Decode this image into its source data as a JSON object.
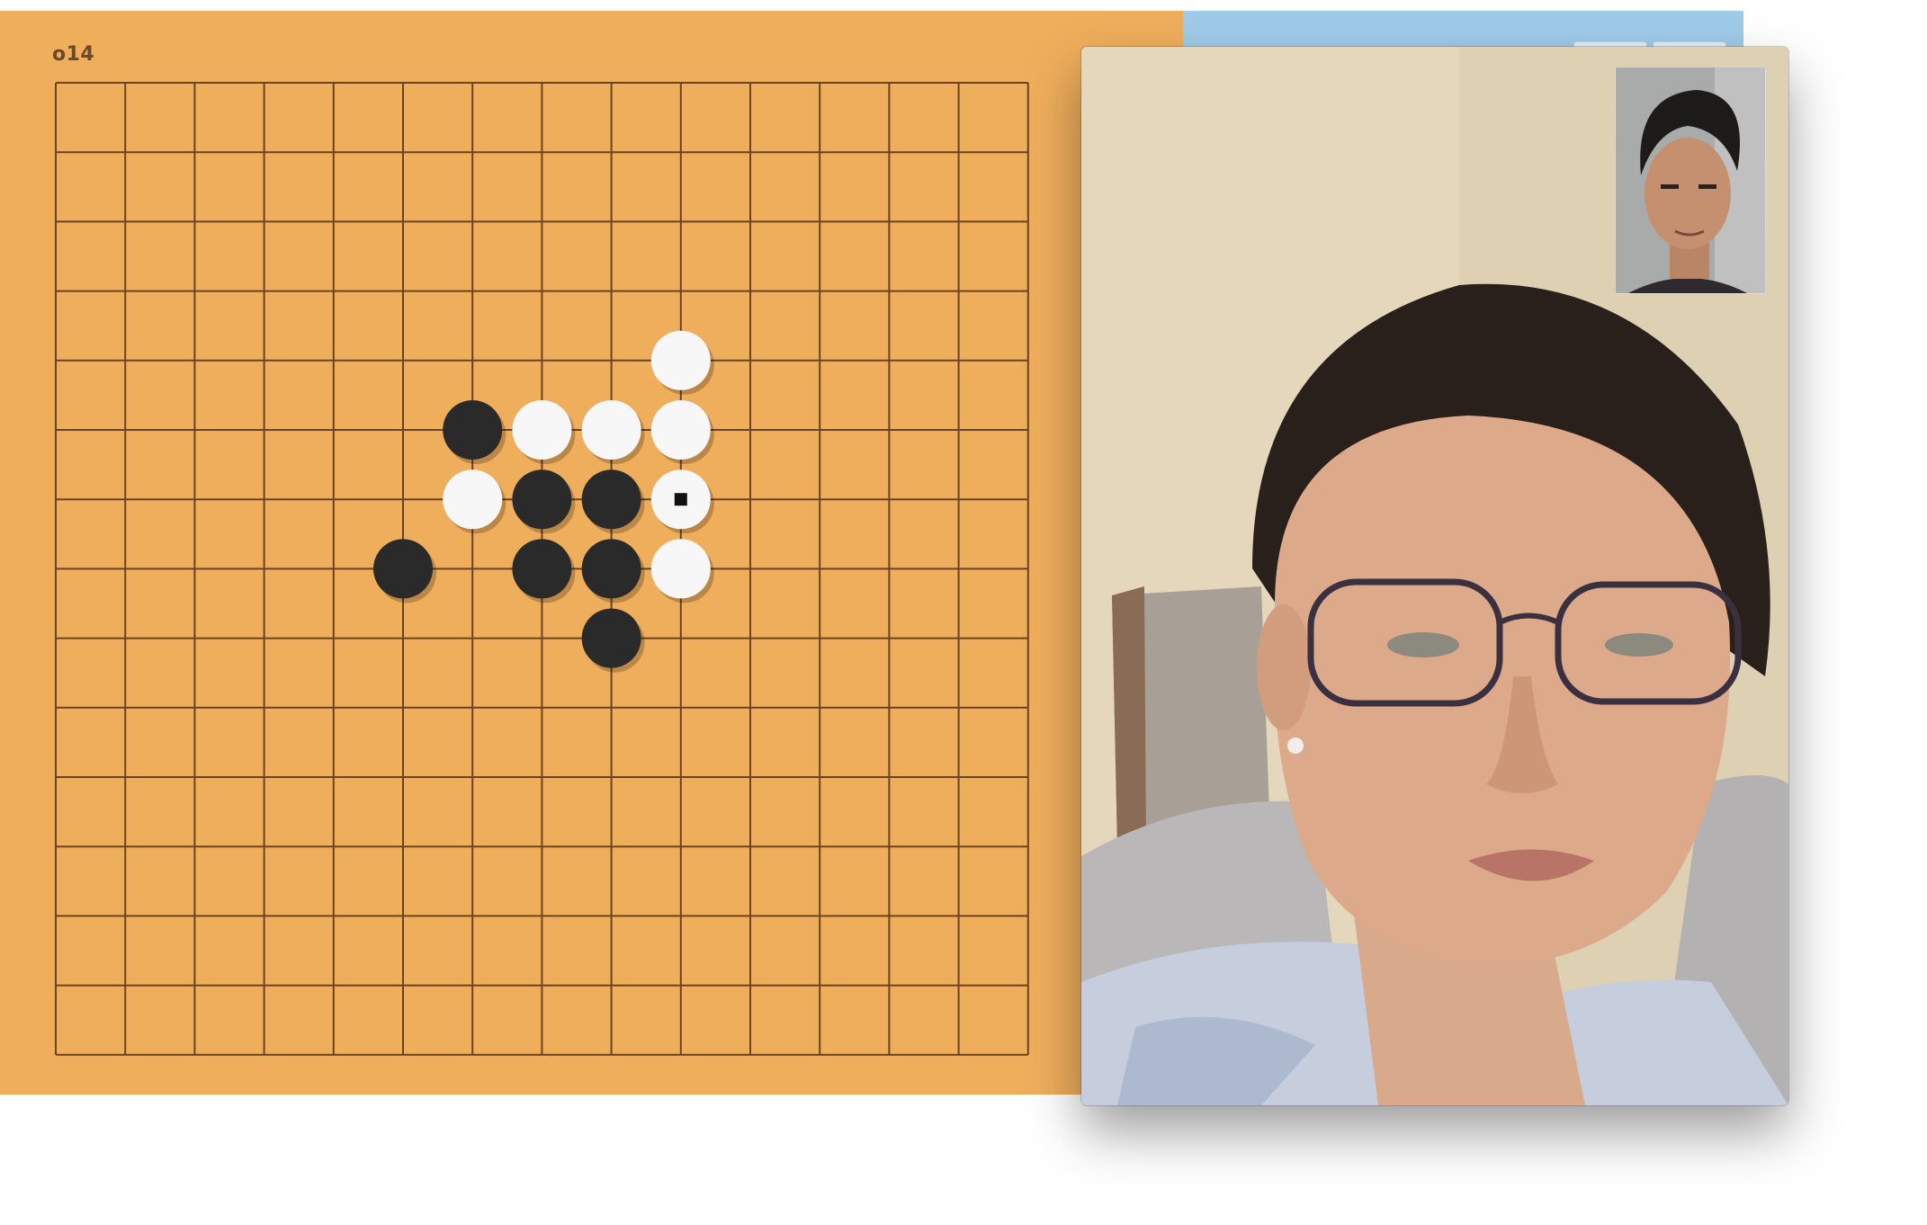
{
  "game": {
    "label": "o14",
    "board_size": 15,
    "colors": {
      "board": "#efae5c",
      "line": "#6b4322",
      "black_stone": "#2a2a2a",
      "white_stone": "#f7f7f7",
      "blue_strip": "#9fcbe9"
    },
    "stones": [
      {
        "col": 9,
        "row": 4,
        "color": "white"
      },
      {
        "col": 6,
        "row": 5,
        "color": "black"
      },
      {
        "col": 7,
        "row": 5,
        "color": "white"
      },
      {
        "col": 8,
        "row": 5,
        "color": "white"
      },
      {
        "col": 9,
        "row": 5,
        "color": "white"
      },
      {
        "col": 6,
        "row": 6,
        "color": "white"
      },
      {
        "col": 7,
        "row": 6,
        "color": "black"
      },
      {
        "col": 8,
        "row": 6,
        "color": "black"
      },
      {
        "col": 9,
        "row": 6,
        "color": "white",
        "last_move": true
      },
      {
        "col": 5,
        "row": 7,
        "color": "black"
      },
      {
        "col": 7,
        "row": 7,
        "color": "black"
      },
      {
        "col": 8,
        "row": 7,
        "color": "black"
      },
      {
        "col": 9,
        "row": 7,
        "color": "white"
      },
      {
        "col": 8,
        "row": 8,
        "color": "black"
      }
    ]
  },
  "video_call": {
    "remote_feed": "remote-video-feed",
    "self_feed": "self-view-feed"
  }
}
